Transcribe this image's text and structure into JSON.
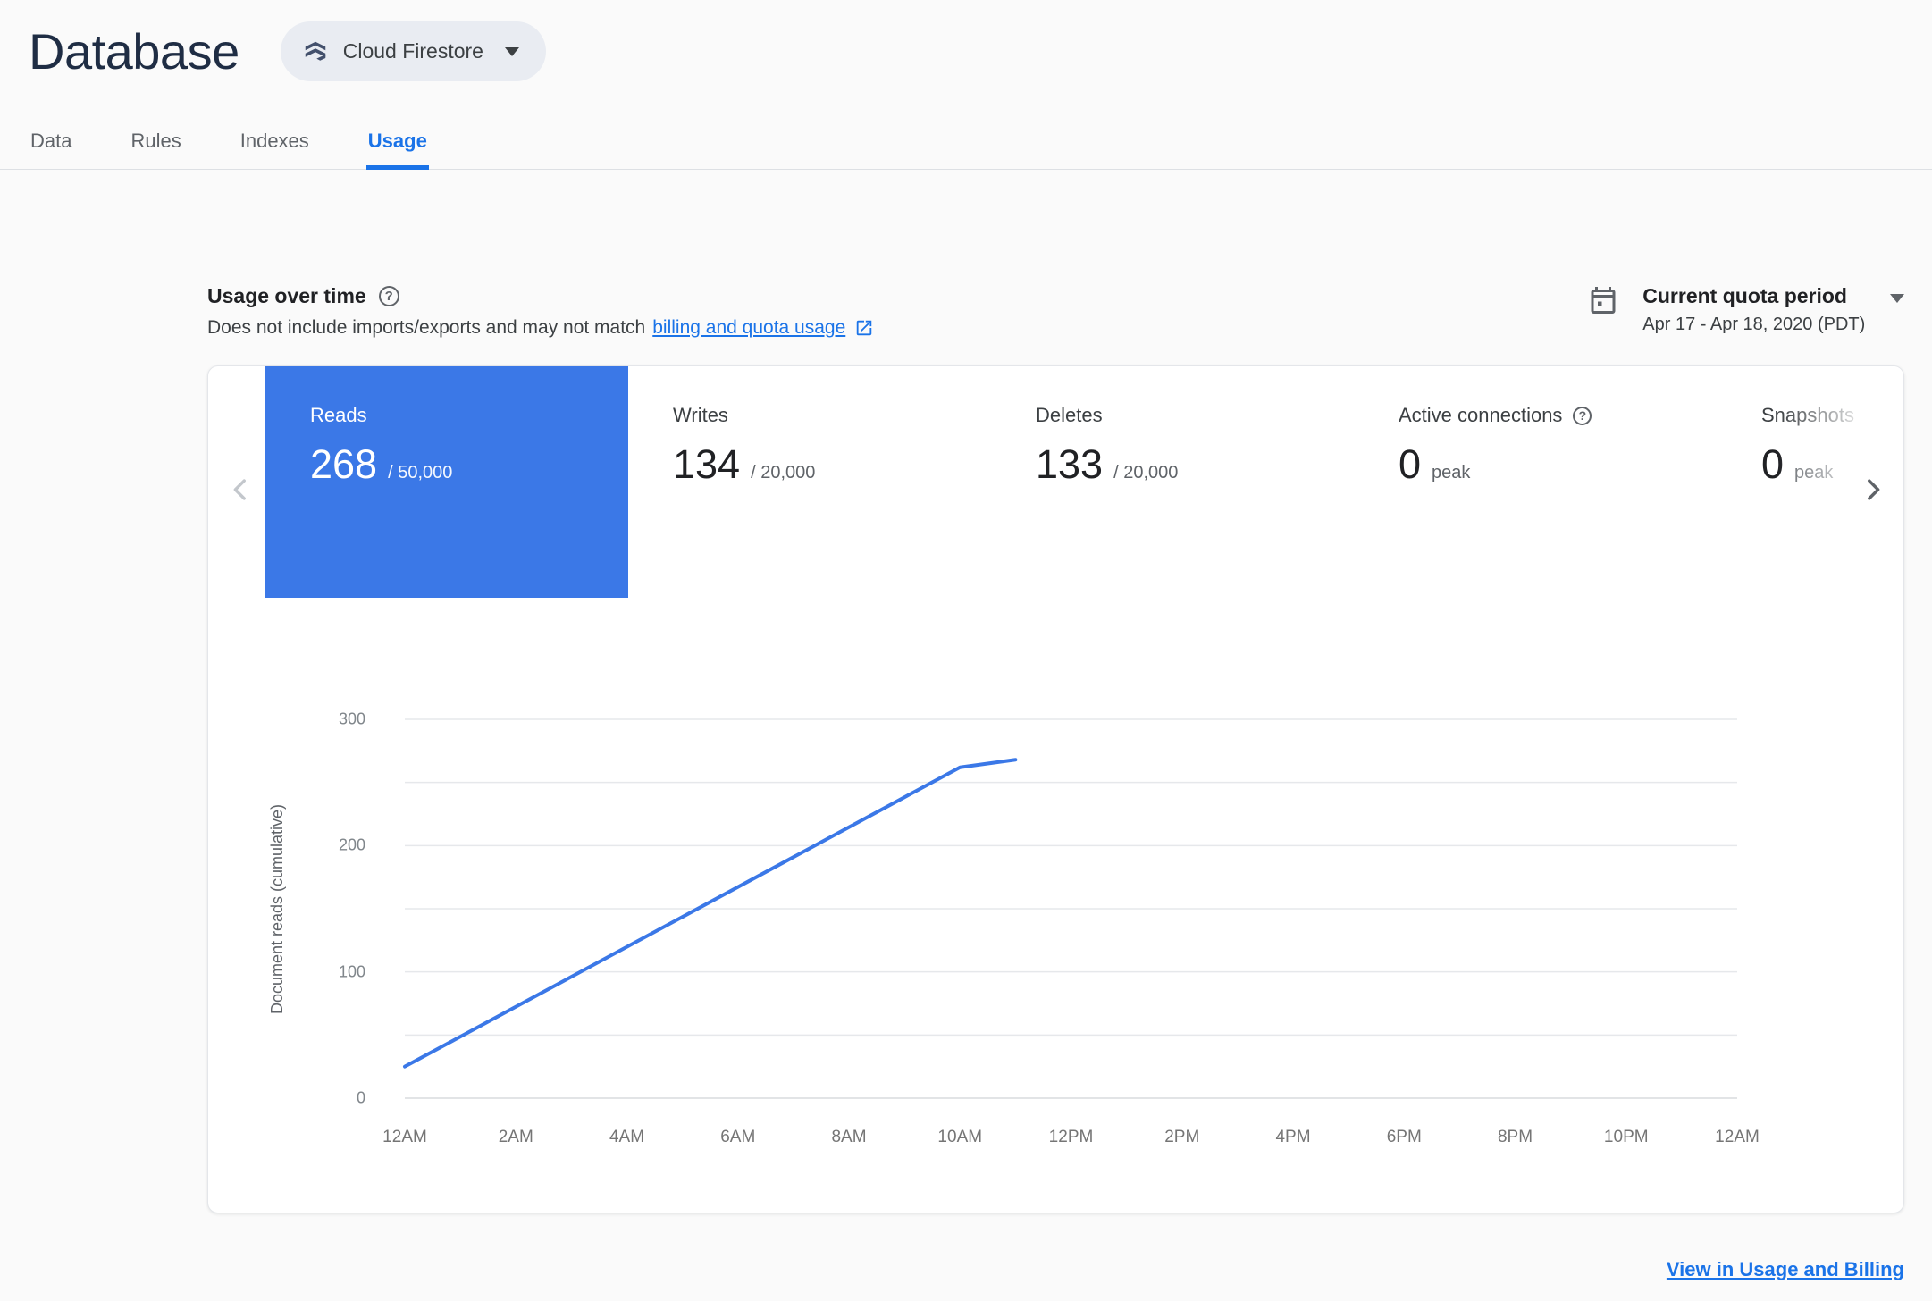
{
  "header": {
    "title": "Database",
    "product_selector": {
      "label": "Cloud Firestore"
    }
  },
  "tabs": [
    {
      "label": "Data",
      "active": false
    },
    {
      "label": "Rules",
      "active": false
    },
    {
      "label": "Indexes",
      "active": false
    },
    {
      "label": "Usage",
      "active": true
    }
  ],
  "usage_section": {
    "title": "Usage over time",
    "subtitle_prefix": "Does not include imports/exports and may not match",
    "subtitle_link": "billing and quota usage",
    "quota_period": {
      "label": "Current quota period",
      "range": "Apr 17 - Apr 18, 2020 (PDT)"
    }
  },
  "metrics": [
    {
      "label": "Reads",
      "value": "268",
      "suffix": "/ 50,000",
      "selected": true,
      "has_help": false
    },
    {
      "label": "Writes",
      "value": "134",
      "suffix": "/ 20,000",
      "selected": false,
      "has_help": false
    },
    {
      "label": "Deletes",
      "value": "133",
      "suffix": "/ 20,000",
      "selected": false,
      "has_help": false
    },
    {
      "label": "Active connections",
      "value": "0",
      "suffix": "peak",
      "selected": false,
      "has_help": true
    },
    {
      "label": "Snapshots",
      "value": "0",
      "suffix": "peak",
      "selected": false,
      "has_help": false
    }
  ],
  "chart_data": {
    "type": "line",
    "ylabel": "Document reads (cumulative)",
    "xlabel": "",
    "x_tick_labels": [
      "12AM",
      "2AM",
      "4AM",
      "6AM",
      "8AM",
      "10AM",
      "12PM",
      "2PM",
      "4PM",
      "6PM",
      "8PM",
      "10PM",
      "12AM"
    ],
    "x_tick_hours": [
      0,
      2,
      4,
      6,
      8,
      10,
      12,
      14,
      16,
      18,
      20,
      22,
      24
    ],
    "xlim_hours": [
      0,
      24
    ],
    "ylim": [
      0,
      300
    ],
    "y_tick_labels": [
      300,
      200,
      100,
      0
    ],
    "y_gridlines": [
      0,
      50,
      100,
      150,
      200,
      250,
      300
    ],
    "grid": true,
    "legend": false,
    "series": [
      {
        "name": "Document reads (cumulative)",
        "color": "#3b78e7",
        "points": [
          {
            "hour": 0,
            "value": 25
          },
          {
            "hour": 10,
            "value": 262
          },
          {
            "hour": 11,
            "value": 268
          }
        ]
      }
    ]
  },
  "footer": {
    "link": "View in Usage and Billing"
  },
  "icons": {
    "help_glyph": "?"
  },
  "colors": {
    "accent": "#1a73e8",
    "selected_tile": "#3b78e7",
    "chart_line": "#3b78e7",
    "gridline": "#e6e8eb",
    "baseline": "#d9dbde"
  }
}
